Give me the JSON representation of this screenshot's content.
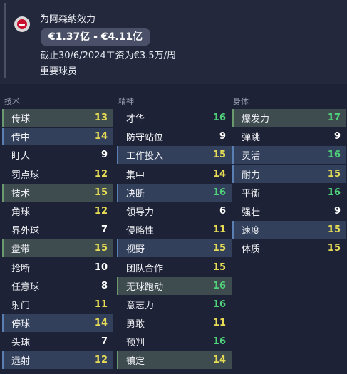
{
  "header": {
    "plays_for": "为阿森纳效力",
    "value_range": "€1.37亿 - €4.11亿",
    "contract": "截止30/6/2024工资为€3.5万/周",
    "role": "重要球员"
  },
  "columns": [
    {
      "title": "技术",
      "attributes": [
        {
          "name": "传球",
          "value": "13",
          "highlight": "green",
          "tier": "yellow"
        },
        {
          "name": "传中",
          "value": "14",
          "highlight": "blue",
          "tier": "yellow"
        },
        {
          "name": "盯人",
          "value": "9",
          "highlight": "",
          "tier": "white"
        },
        {
          "name": "罚点球",
          "value": "12",
          "highlight": "",
          "tier": "yellow"
        },
        {
          "name": "技术",
          "value": "15",
          "highlight": "green",
          "tier": "yellow"
        },
        {
          "name": "角球",
          "value": "12",
          "highlight": "",
          "tier": "yellow"
        },
        {
          "name": "界外球",
          "value": "7",
          "highlight": "",
          "tier": "white"
        },
        {
          "name": "盘带",
          "value": "15",
          "highlight": "green",
          "tier": "yellow"
        },
        {
          "name": "抢断",
          "value": "10",
          "highlight": "",
          "tier": "white"
        },
        {
          "name": "任意球",
          "value": "8",
          "highlight": "",
          "tier": "white"
        },
        {
          "name": "射门",
          "value": "11",
          "highlight": "",
          "tier": "yellow"
        },
        {
          "name": "停球",
          "value": "14",
          "highlight": "blue",
          "tier": "yellow"
        },
        {
          "name": "头球",
          "value": "7",
          "highlight": "",
          "tier": "white"
        },
        {
          "name": "远射",
          "value": "12",
          "highlight": "blue",
          "tier": "yellow"
        }
      ]
    },
    {
      "title": "精神",
      "attributes": [
        {
          "name": "才华",
          "value": "16",
          "highlight": "",
          "tier": "green"
        },
        {
          "name": "防守站位",
          "value": "9",
          "highlight": "",
          "tier": "white"
        },
        {
          "name": "工作投入",
          "value": "15",
          "highlight": "blue",
          "tier": "yellow"
        },
        {
          "name": "集中",
          "value": "14",
          "highlight": "",
          "tier": "yellow"
        },
        {
          "name": "决断",
          "value": "16",
          "highlight": "blue",
          "tier": "green"
        },
        {
          "name": "领导力",
          "value": "6",
          "highlight": "",
          "tier": "white"
        },
        {
          "name": "侵略性",
          "value": "11",
          "highlight": "",
          "tier": "yellow"
        },
        {
          "name": "视野",
          "value": "15",
          "highlight": "blue",
          "tier": "yellow"
        },
        {
          "name": "团队合作",
          "value": "15",
          "highlight": "",
          "tier": "yellow"
        },
        {
          "name": "无球跑动",
          "value": "16",
          "highlight": "green",
          "tier": "green"
        },
        {
          "name": "意志力",
          "value": "16",
          "highlight": "",
          "tier": "green"
        },
        {
          "name": "勇敢",
          "value": "11",
          "highlight": "",
          "tier": "yellow"
        },
        {
          "name": "预判",
          "value": "16",
          "highlight": "",
          "tier": "green"
        },
        {
          "name": "镇定",
          "value": "14",
          "highlight": "green",
          "tier": "yellow"
        }
      ]
    },
    {
      "title": "身体",
      "attributes": [
        {
          "name": "爆发力",
          "value": "17",
          "highlight": "green",
          "tier": "green"
        },
        {
          "name": "弹跳",
          "value": "9",
          "highlight": "",
          "tier": "white"
        },
        {
          "name": "灵活",
          "value": "16",
          "highlight": "blue",
          "tier": "green"
        },
        {
          "name": "耐力",
          "value": "15",
          "highlight": "blue",
          "tier": "yellow"
        },
        {
          "name": "平衡",
          "value": "16",
          "highlight": "",
          "tier": "green"
        },
        {
          "name": "强壮",
          "value": "9",
          "highlight": "",
          "tier": "white"
        },
        {
          "name": "速度",
          "value": "15",
          "highlight": "blue",
          "tier": "yellow"
        },
        {
          "name": "体质",
          "value": "15",
          "highlight": "",
          "tier": "yellow"
        }
      ]
    }
  ],
  "colors": {
    "background": "#1e2236",
    "highlight_green": "#3f4c4f",
    "highlight_blue": "#33405c",
    "value_green": "#4fd27a",
    "value_yellow": "#e6dc55",
    "value_white": "#ffffff"
  }
}
